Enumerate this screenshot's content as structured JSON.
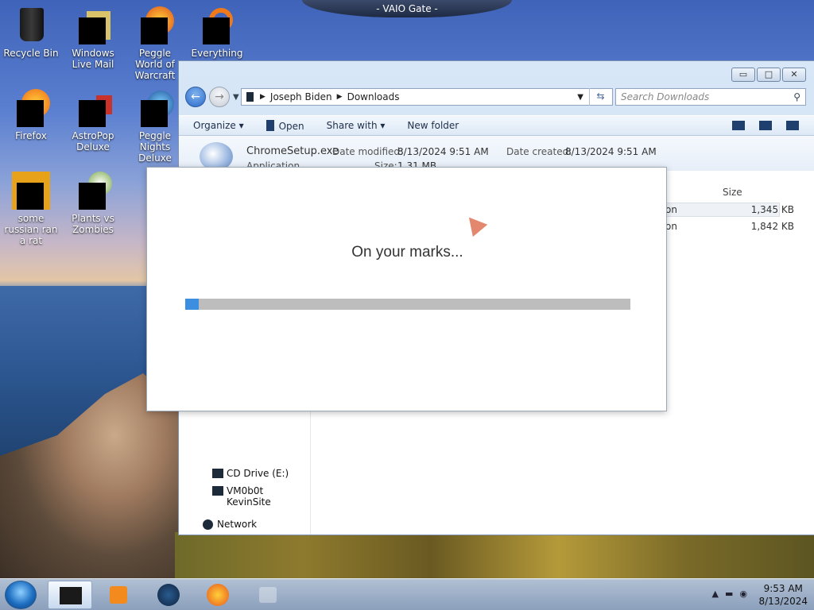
{
  "top_tab": "- VAIO Gate -",
  "desktop_icons": [
    {
      "label": "Recycle Bin"
    },
    {
      "label": "Windows Live Mail"
    },
    {
      "label": "Peggle World of Warcraft"
    },
    {
      "label": "Everything"
    },
    {
      "label": "Firefox"
    },
    {
      "label": "AstroPop Deluxe"
    },
    {
      "label": "Peggle Nights Deluxe"
    },
    {
      "label": "some russian ran a rat"
    },
    {
      "label": "Plants vs Zombies"
    }
  ],
  "explorer": {
    "breadcrumb": [
      "Joseph Biden",
      "Downloads"
    ],
    "search_placeholder": "Search Downloads",
    "toolbar": [
      "Organize ▾",
      "Open",
      "Share with ▾",
      "New folder"
    ],
    "selected_file": {
      "name": "ChromeSetup.exe",
      "date_modified_label": "Date modified:",
      "date_modified": "8/13/2024 9:51 AM",
      "date_created_label": "Date created:",
      "date_created": "8/13/2024 9:51 AM",
      "type": "Application",
      "size_label": "Size:",
      "size": "1.31 MB"
    },
    "size_header": "Size",
    "rows": [
      {
        "type_fragment": "on",
        "size": "1,345 KB"
      },
      {
        "type_fragment": "on",
        "size": "1,842 KB"
      }
    ],
    "sidebar": [
      "CD Drive (E:)",
      "VM0b0t KevinSite",
      "Network"
    ]
  },
  "dialog": {
    "message": "On your marks...",
    "progress": 0.03
  },
  "taskbar": {
    "time": "9:53 AM",
    "date": "8/13/2024"
  },
  "colors": {
    "accent": "#3b8ee0",
    "track": "#bdbdbd"
  }
}
